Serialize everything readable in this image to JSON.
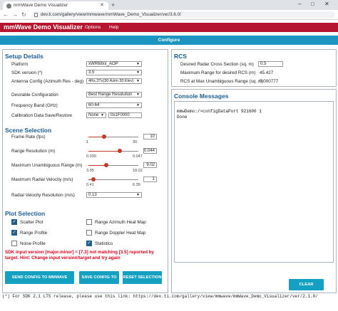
{
  "browser": {
    "tab_title": "mmWave Demo Visualizer",
    "url": "dev.ti.com/gallery/view/mmwave/mmWave_Demo_Visualizer/ver/3.6.0/"
  },
  "app": {
    "brand": "mmWave Demo Visualizer",
    "menu": [
      "Options",
      "Help"
    ],
    "config_label": "Configure"
  },
  "setup": {
    "title": "Setup Details",
    "rows": [
      {
        "label": "Platform",
        "value": "xWR68xx_AOP"
      },
      {
        "label": "SDK version (*)",
        "value": "3.5"
      },
      {
        "label": "Antenna Config (Azimuth Res - deg)",
        "value": "4Rx,3Tx(30 Azim 30 Elev)"
      }
    ],
    "desirable_label": "Desirable Configuration",
    "desirable_value": "Best Range Resolution",
    "freq_label": "Frequency Band (GHz)",
    "freq_value": "60-64",
    "calib_label": "Calibration Data Save/Restore",
    "calib_value": "None",
    "calib_addr": "0x1F0000"
  },
  "scene": {
    "title": "Scene Selection",
    "sliders": [
      {
        "label": "Frame Rate (fps)",
        "min": "1",
        "max": "30",
        "min_n": 1,
        "max_n": 30,
        "current": 10,
        "value": "10"
      },
      {
        "label": "Range Resolution (m)",
        "min": "0.039",
        "max": "0.047",
        "min_n": 0.039,
        "max_n": 0.047,
        "current": 0.044,
        "value": "0.044"
      },
      {
        "label": "Maximum Unambiguous Range (m)",
        "min": "3.95",
        "max": "18.02",
        "min_n": 3.95,
        "max_n": 18.02,
        "current": 9.02,
        "value": "9.02"
      },
      {
        "label": "Maximum Radial Velocity (m/s)",
        "min": "0.41",
        "max": "6.39",
        "min_n": 0.41,
        "max_n": 6.39,
        "current": 1,
        "value": "1"
      }
    ],
    "radial_label": "Radial Velocity Resolution (m/s)",
    "radial_value": "0.13"
  },
  "plot": {
    "title": "Plot Selection",
    "left": [
      {
        "label": "Scatter Plot",
        "checked": true
      },
      {
        "label": "Range Profile",
        "checked": true
      },
      {
        "label": "Noise Profile",
        "checked": false
      }
    ],
    "right": [
      {
        "label": "Range Azimuth Heat Map",
        "checked": false
      },
      {
        "label": "Range Doppler Heat Map",
        "checked": false
      },
      {
        "label": "Statistics",
        "checked": true
      }
    ],
    "check_glyph": "✓"
  },
  "warning": "SDK input version [major.minor] = [7.3] not matching [3.5] reported by target. Hint: Change input version/target and try again",
  "buttons": {
    "send": "SEND CONFIG TO MMWAVE DEVICE",
    "save": "SAVE CONFIG TO PC",
    "reset": "RESET SELECTION",
    "clear": "CLEAR CONSOLE"
  },
  "rcs": {
    "title": "RCS",
    "rows": [
      {
        "label": "Desired Radar Cross Section (sq. m)",
        "value": "0.5"
      },
      {
        "label": "Maximum Range for desired RCS (m)",
        "value": "45.427"
      },
      {
        "label": "RCS at Max Unambiguous Range (sq. m)",
        "value": "0.000777"
      }
    ]
  },
  "console": {
    "title": "Console Messages",
    "text": "mmwDemo:/>configDataPort 921600 1\nDone"
  },
  "footer": "(*) For SDK 2.1 LTS release, please use this link: https://dev.ti.com/gallery/view/mmwave/mmWave_Demo_Visualizer/ver/2.1.0/",
  "colors": {
    "brand_red": "#b5152f",
    "accent_blue": "#1c95c0",
    "button_teal": "#14a0c0",
    "warning_red": "#d9001b"
  }
}
